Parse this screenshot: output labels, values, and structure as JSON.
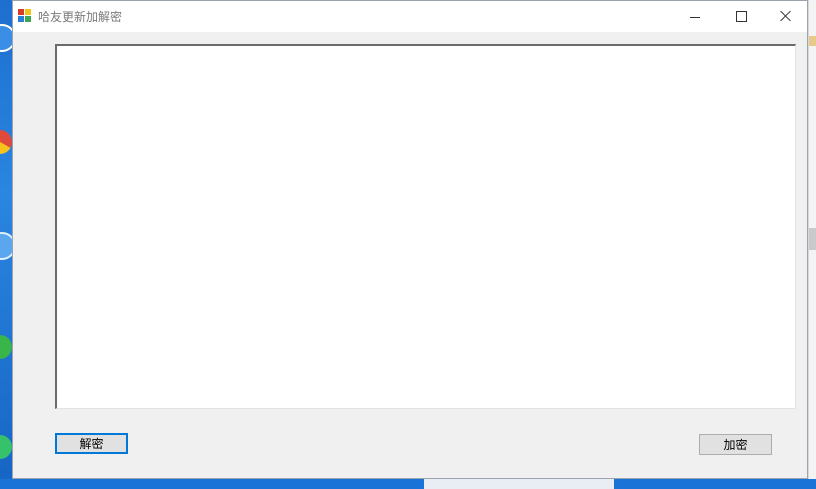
{
  "window": {
    "title": "哈友更新加解密"
  },
  "editor": {
    "value": ""
  },
  "buttons": {
    "decrypt_label": "解密",
    "encrypt_label": "加密"
  },
  "icons": {
    "app": "app-icon",
    "minimize": "minimize-icon",
    "maximize": "maximize-icon",
    "close": "close-icon"
  },
  "colors": {
    "focus_border": "#0078d7",
    "window_bg": "#f0f0f0",
    "button_bg": "#e1e1e1"
  }
}
